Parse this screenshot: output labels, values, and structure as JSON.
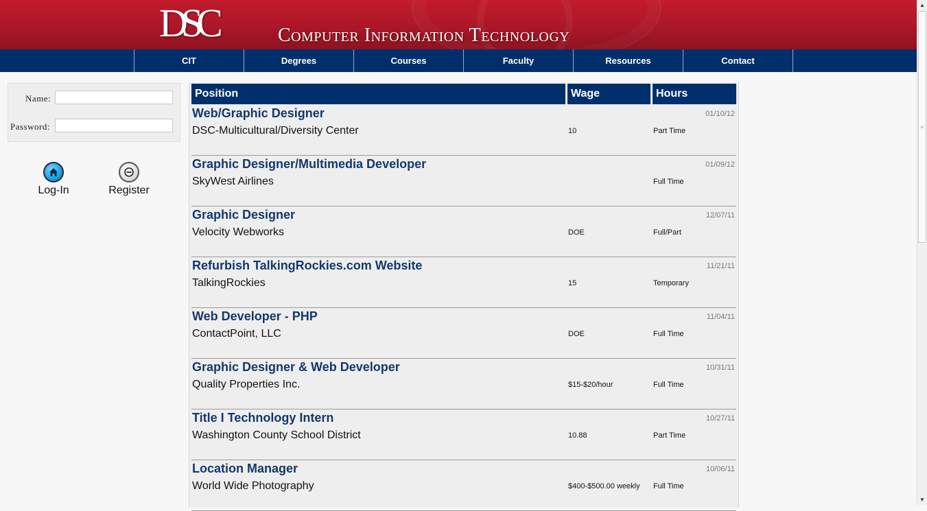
{
  "header": {
    "logo_text": "DSC",
    "title": "Computer Information Technology"
  },
  "nav": {
    "items": [
      {
        "label": "CIT"
      },
      {
        "label": "Degrees"
      },
      {
        "label": "Courses"
      },
      {
        "label": "Faculty"
      },
      {
        "label": "Resources"
      },
      {
        "label": "Contact"
      }
    ]
  },
  "login": {
    "name_label": "Name:",
    "name_value": "",
    "password_label": "Password:",
    "password_value": "",
    "login_label": "Log-In",
    "register_label": "Register"
  },
  "table": {
    "columns": [
      "Position",
      "Wage",
      "Hours"
    ],
    "rows": [
      {
        "title": "Web/Graphic Designer",
        "company": "DSC-Multicultural/Diversity Center",
        "date": "01/10/12",
        "wage": "10",
        "hours": "Part Time"
      },
      {
        "title": "Graphic Designer/Multimedia Developer",
        "company": "SkyWest Airlines",
        "date": "01/09/12",
        "wage": "",
        "hours": "Full Time"
      },
      {
        "title": "Graphic Designer",
        "company": "Velocity Webworks",
        "date": "12/07/11",
        "wage": "DOE",
        "hours": "Full/Part"
      },
      {
        "title": "Refurbish TalkingRockies.com Website",
        "company": "TalkingRockies",
        "date": "11/21/11",
        "wage": "15",
        "hours": "Temporary"
      },
      {
        "title": "Web Developer - PHP",
        "company": "ContactPoint, LLC",
        "date": "11/04/11",
        "wage": "DOE",
        "hours": "Full Time"
      },
      {
        "title": "Graphic Designer & Web Developer",
        "company": "Quality Properties Inc.",
        "date": "10/31/11",
        "wage": "$15-$20/hour",
        "hours": "Full Time"
      },
      {
        "title": "Title I Technology Intern",
        "company": "Washington County School District",
        "date": "10/27/11",
        "wage": "10.88",
        "hours": "Part Time"
      },
      {
        "title": "Location Manager",
        "company": "World Wide Photography",
        "date": "10/06/11",
        "wage": "$400-$500.00 weekly",
        "hours": "Full Time"
      }
    ]
  },
  "icons": {
    "login": "home-icon",
    "register": "minus-circle-icon"
  },
  "colors": {
    "header_red": "#b0182a",
    "nav_blue": "#002f6c",
    "link_blue": "#13386b"
  }
}
